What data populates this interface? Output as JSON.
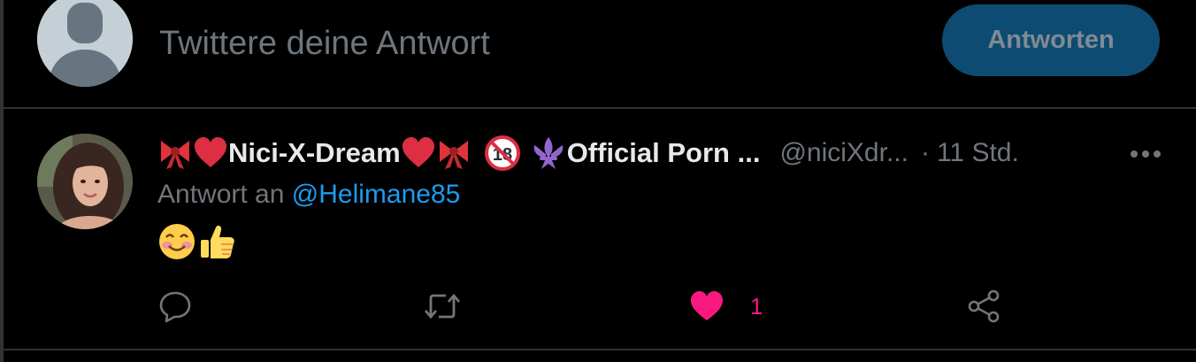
{
  "compose": {
    "placeholder": "Twittere deine Antwort",
    "reply_button_label": "Antworten"
  },
  "tweet": {
    "display_name_prefix_emojis": [
      "ribbon",
      "red-heart"
    ],
    "display_name_text": "Nici-X-Dream",
    "display_name_suffix_emojis": [
      "red-heart",
      "ribbon",
      "no-one-under-eighteen",
      "fleur-de-lis"
    ],
    "display_name_tail": "Official Porn ...",
    "handle": "@niciXdr...",
    "separator": "·",
    "time": "11 Std.",
    "reply_prefix": "Antwort an",
    "reply_mention": "@Helimane85",
    "body_emojis": [
      "smiling-face-with-smiling-eyes",
      "thumbs-up"
    ],
    "like_count": "1",
    "liked": true
  },
  "colors": {
    "background": "#000000",
    "border": "#2f3336",
    "muted_text": "#71767b",
    "link": "#1d9bf0",
    "like_pink": "#f91880",
    "disabled_button_bg": "#0e4b72"
  }
}
